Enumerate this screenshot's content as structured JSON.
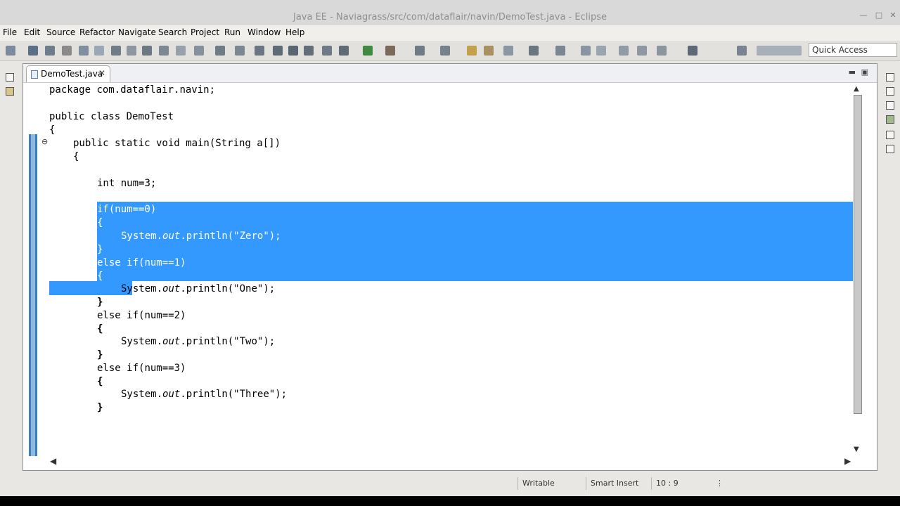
{
  "window": {
    "title": "Java EE - Naviagrass/src/com/dataflair/navin/DemoTest.java - Eclipse"
  },
  "menu": [
    "File",
    "Edit",
    "Source",
    "Refactor",
    "Navigate",
    "Search",
    "Project",
    "Run",
    "Window",
    "Help"
  ],
  "toolbar": {
    "quick_access_placeholder": "Quick Access"
  },
  "editor": {
    "tab_label": "DemoTest.java",
    "code": {
      "l1a": "package",
      "l1b": " com.dataflair.navin;",
      "l2a": "public class",
      "l2b": " DemoTest",
      "l3": "{",
      "l4a": "public static void",
      "l4b": " main(String a[])",
      "l5": "{",
      "l6a": "int",
      "l6b": " num=3;",
      "l7a": "if",
      "l7b": "(num==0)",
      "l8": "{",
      "l9a": "System.",
      "l9b": "out",
      "l9c": ".println(",
      "l9d": "\"Zero\"",
      "l9e": ");",
      "l10": "}",
      "l11a": "else if",
      "l11b": "(num==1)",
      "l12": "{",
      "l13a": "System.",
      "l13b": "out",
      "l13c": ".println(",
      "l13d": "\"One\"",
      "l13e": ");",
      "l14": "}",
      "l15a": "else if",
      "l15b": "(num==2)",
      "l16": "{",
      "l17a": "System.",
      "l17b": "out",
      "l17c": ".println(",
      "l17d": "\"Two\"",
      "l17e": ");",
      "l18": "}",
      "l19a": "else if",
      "l19b": "(num==3)",
      "l20": "{",
      "l21a": "System.",
      "l21b": "out",
      "l21c": ".println(",
      "l21d": "\"Three\"",
      "l21e": ");",
      "l22": "}"
    }
  },
  "status": {
    "writable": "Writable",
    "insert_mode": "Smart Insert",
    "position": "10 : 9"
  },
  "colors": {
    "selection": "#3399ff",
    "keyword": "#7f0055",
    "string": "#2a00ff"
  }
}
